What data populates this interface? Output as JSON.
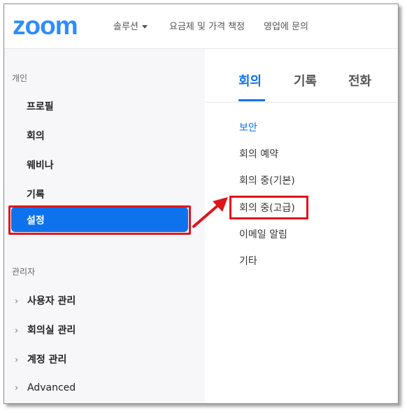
{
  "header": {
    "logo": "zoom",
    "nav": [
      {
        "label": "솔루션",
        "has_dropdown": true
      },
      {
        "label": "요금제 및 가격 책정"
      },
      {
        "label": "영업에 문의"
      }
    ]
  },
  "sidebar": {
    "personal_label": "개인",
    "personal_items": [
      "프로필",
      "회의",
      "웨비나",
      "기록",
      "설정"
    ],
    "admin_label": "관리자",
    "admin_items": [
      "사용자 관리",
      "회의실 관리",
      "계정 관리",
      "Advanced"
    ]
  },
  "main": {
    "tabs": [
      "회의",
      "기록",
      "전화"
    ],
    "sub_items": [
      "보안",
      "회의 예약",
      "회의 중(기본)",
      "회의 중(고급)",
      "이메일 알림",
      "기타"
    ]
  },
  "colors": {
    "brand": "#2d8cff",
    "accent": "#0e72ed",
    "highlight_annotation": "#e0141b"
  }
}
